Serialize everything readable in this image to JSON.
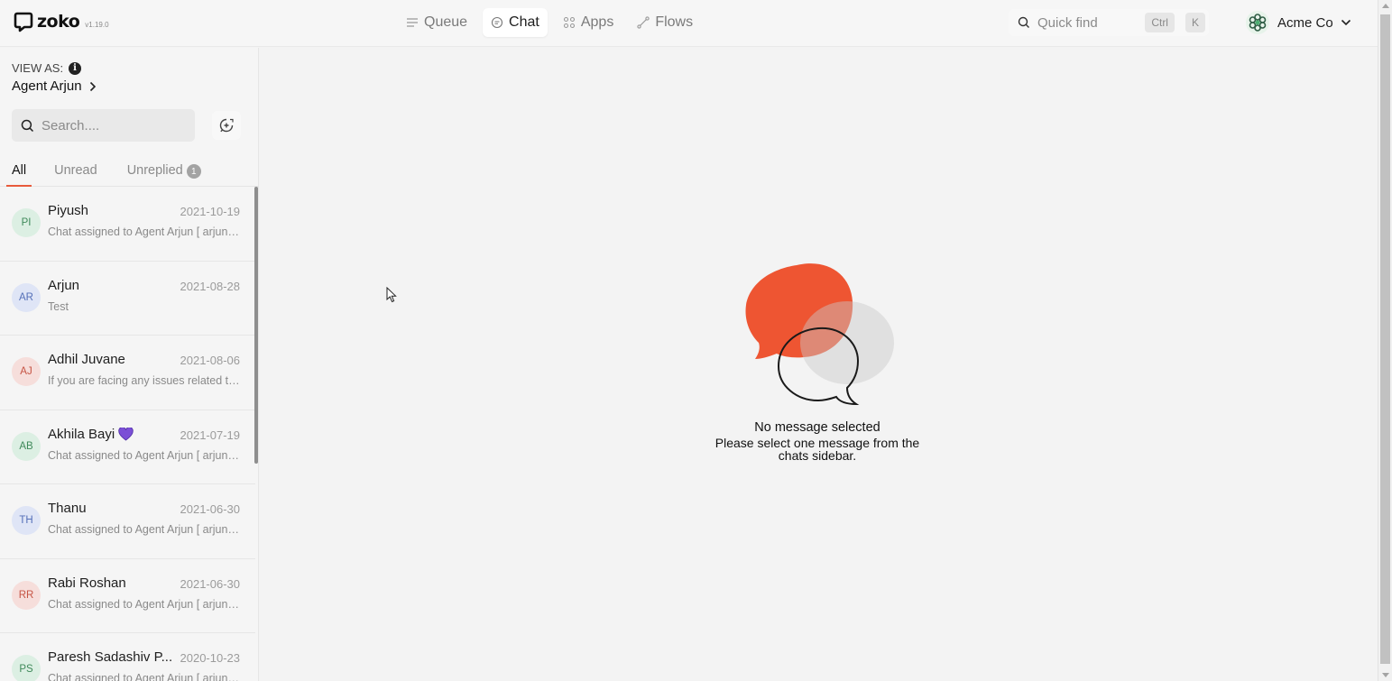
{
  "brand": {
    "name": "zoko",
    "version": "v1.19.0"
  },
  "nav": [
    {
      "label": "Queue",
      "icon": "queue-icon"
    },
    {
      "label": "Chat",
      "icon": "chat-icon",
      "active": true
    },
    {
      "label": "Apps",
      "icon": "apps-icon"
    },
    {
      "label": "Flows",
      "icon": "flows-icon"
    }
  ],
  "quick_find": {
    "label": "Quick find",
    "key1": "Ctrl",
    "key2": "K"
  },
  "account": {
    "name": "Acme Co"
  },
  "sidebar": {
    "view_as_label": "VIEW AS:",
    "agent": "Agent Arjun",
    "search_placeholder": "Search....",
    "tabs": [
      {
        "label": "All",
        "active": true
      },
      {
        "label": "Unread"
      },
      {
        "label": "Unreplied",
        "badge": "1"
      }
    ],
    "chats": [
      {
        "initials": "PI",
        "name": "Piyush",
        "date": "2021-10-19",
        "preview": "Chat assigned to Agent Arjun [ arjun@zoko.io ]"
      },
      {
        "initials": "AR",
        "name": "Arjun",
        "date": "2021-08-28",
        "preview": "Test"
      },
      {
        "initials": "AJ",
        "name": "Adhil Juvane",
        "date": "2021-08-06",
        "preview": "If you are facing any issues related to your order"
      },
      {
        "initials": "AB",
        "name": "Akhila Bayi",
        "date": "2021-07-19",
        "preview": "Chat assigned to Agent Arjun [ arjun@zoko.io ]"
      },
      {
        "initials": "TH",
        "name": "Thanu",
        "date": "2021-06-30",
        "preview": "Chat assigned to Agent Arjun [ arjun@zoko.io ]"
      },
      {
        "initials": "RR",
        "name": "Rabi Roshan",
        "date": "2021-06-30",
        "preview": "Chat assigned to Agent Arjun [ arjun@zoko.io ]"
      },
      {
        "initials": "PS",
        "name": "Paresh Sadashiv P...",
        "date": "2020-10-23",
        "preview": "Chat assigned to Agent Arjun [ arjun@zoko.io ]"
      }
    ]
  },
  "empty_state": {
    "title": "No message selected",
    "subtitle": "Please select one message from the chats sidebar."
  },
  "colors": {
    "accent": "#e85a3b",
    "avatar_green_bg": "#dcefe3",
    "avatar_green_fg": "#3f8a5a",
    "avatar_blue_bg": "#dfe5f6",
    "avatar_blue_fg": "#5570b8",
    "avatar_red_bg": "#f6dedb",
    "avatar_red_fg": "#c65444",
    "heart": "#7b4fd6"
  }
}
